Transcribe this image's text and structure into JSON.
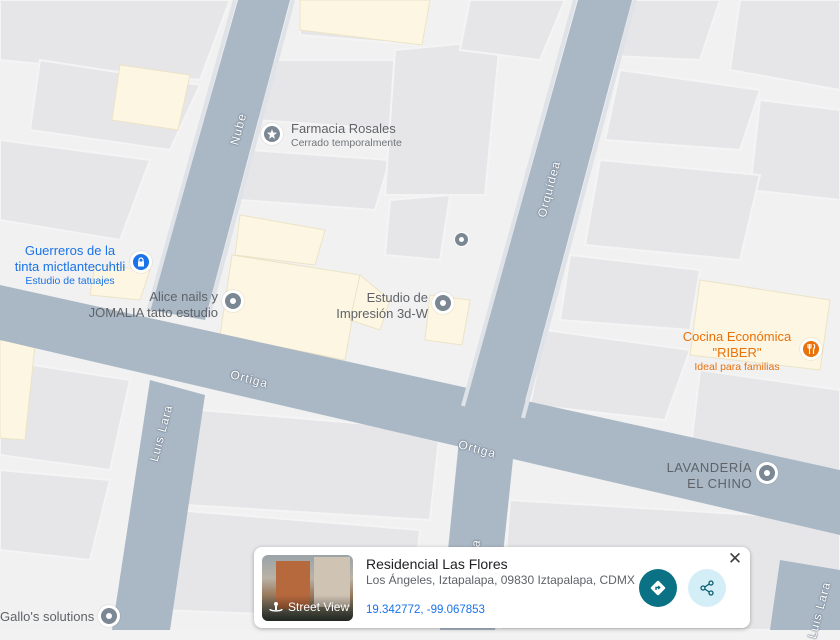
{
  "map": {
    "places": [
      {
        "name": "Farmacia Rosales",
        "sub": "Cerrado temporalmente"
      },
      {
        "name_line1": "Guerreros de la",
        "name_line2": "tinta mictlantecuhtli",
        "sub": "Estudio de tatuajes"
      },
      {
        "name_line1": "Alice nails y",
        "name_line2": "JOMALIA tatto estudio"
      },
      {
        "name_line1": "Estudio de",
        "name_line2": "Impresión 3d-W"
      },
      {
        "name_line1": "Cocina Económica",
        "name_line2": "\"RIBER\"",
        "sub": "Ideal para familias"
      },
      {
        "name_line1": "LAVANDERÍA",
        "name_line2": "EL CHINO"
      },
      {
        "name": "Gallo's solutions"
      }
    ],
    "streets": {
      "nube": "Nube",
      "orquidea": "Orquídea",
      "ortiga_1": "Ortiga",
      "ortiga_2": "Ortiga",
      "luis_lara": "Luis Lara",
      "bottom_a": "a",
      "bottom_right": "Luis Lara"
    },
    "colors": {
      "road": "#aab8c6",
      "block": "#e8e9ec",
      "building": "#dadce0",
      "highlight": "#fdf6e3",
      "place_blue": "#1a73e8",
      "place_orange": "#e8710a",
      "place_gray": "#70757a"
    }
  },
  "card": {
    "title": "Residencial Las Flores",
    "address": "Los Ángeles, Iztapalapa, 09830 Iztapalapa, CDMX",
    "coords": "19.342772, -99.067853",
    "street_view_label": "Street View",
    "close_icon": "close-icon",
    "directions_icon": "directions-icon",
    "share_icon": "share-icon"
  }
}
